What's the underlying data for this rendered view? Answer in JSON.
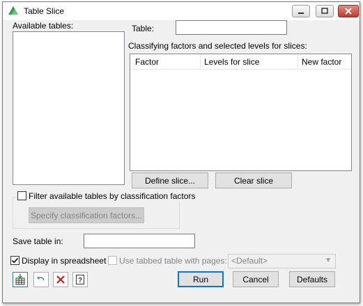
{
  "window": {
    "title": "Table Slice"
  },
  "available_tables": {
    "label": "Available tables:",
    "items": []
  },
  "table": {
    "label": "Table:",
    "value": ""
  },
  "slices": {
    "label": "Classifying factors and selected levels for slices:",
    "columns": [
      "Factor",
      "Levels for slice",
      "New factor"
    ],
    "rows": []
  },
  "buttons": {
    "define_slice": "Define slice...",
    "clear_slice": "Clear slice",
    "specify_factors": "Specify classification factors...",
    "run": "Run",
    "cancel": "Cancel",
    "defaults": "Defaults"
  },
  "filter": {
    "label": "Filter available tables by classification factors",
    "checked": false
  },
  "save_table": {
    "label": "Save table in:",
    "value": ""
  },
  "display_spreadsheet": {
    "label": "Display in spreadsheet",
    "checked": true
  },
  "tabbed_table": {
    "label": "Use tabbed table with pages:",
    "checked": false,
    "enabled": false
  },
  "pages_select": {
    "value": "<Default>"
  },
  "colors": {
    "title_icon": "#2e9d45",
    "close_button": "#c4392b",
    "default_button_border": "#0078d7",
    "undo_icon": "#4a7cc0",
    "delete_icon": "#c0231d"
  },
  "toolbar_icons": [
    "save-to-spreadsheet-icon",
    "undo-icon",
    "delete-icon",
    "help-icon"
  ]
}
